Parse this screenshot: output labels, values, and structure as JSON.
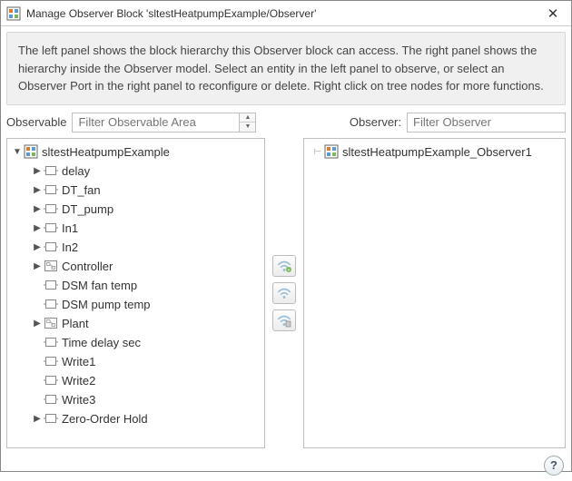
{
  "title": "Manage Observer Block 'sltestHeatpumpExample/Observer'",
  "instructions": "The left panel shows the block hierarchy this Observer block can access. The right panel shows the hierarchy inside the Observer model. Select an entity in the left panel to observe, or select an Observer Port in the right panel to reconfigure or delete. Right click on tree nodes for more functions.",
  "left": {
    "label": "Observable",
    "placeholder": "Filter Observable Area"
  },
  "right": {
    "label": "Observer:",
    "placeholder": "Filter Observer"
  },
  "tree": {
    "root": "sltestHeatpumpExample",
    "items": [
      {
        "label": "delay",
        "expandable": true
      },
      {
        "label": "DT_fan",
        "expandable": true
      },
      {
        "label": "DT_pump",
        "expandable": true
      },
      {
        "label": "In1",
        "expandable": true
      },
      {
        "label": "In2",
        "expandable": true
      },
      {
        "label": "Controller",
        "expandable": true,
        "icon": "subsys"
      },
      {
        "label": "DSM fan temp",
        "expandable": false
      },
      {
        "label": "DSM pump temp",
        "expandable": false
      },
      {
        "label": "Plant",
        "expandable": true,
        "icon": "subsys"
      },
      {
        "label": "Time delay sec",
        "expandable": false
      },
      {
        "label": "Write1",
        "expandable": false
      },
      {
        "label": "Write2",
        "expandable": false
      },
      {
        "label": "Write3",
        "expandable": false
      },
      {
        "label": "Zero-Order Hold",
        "expandable": true
      }
    ]
  },
  "observer_tree": {
    "root": "sltestHeatpumpExample_Observer1"
  },
  "help_symbol": "?"
}
